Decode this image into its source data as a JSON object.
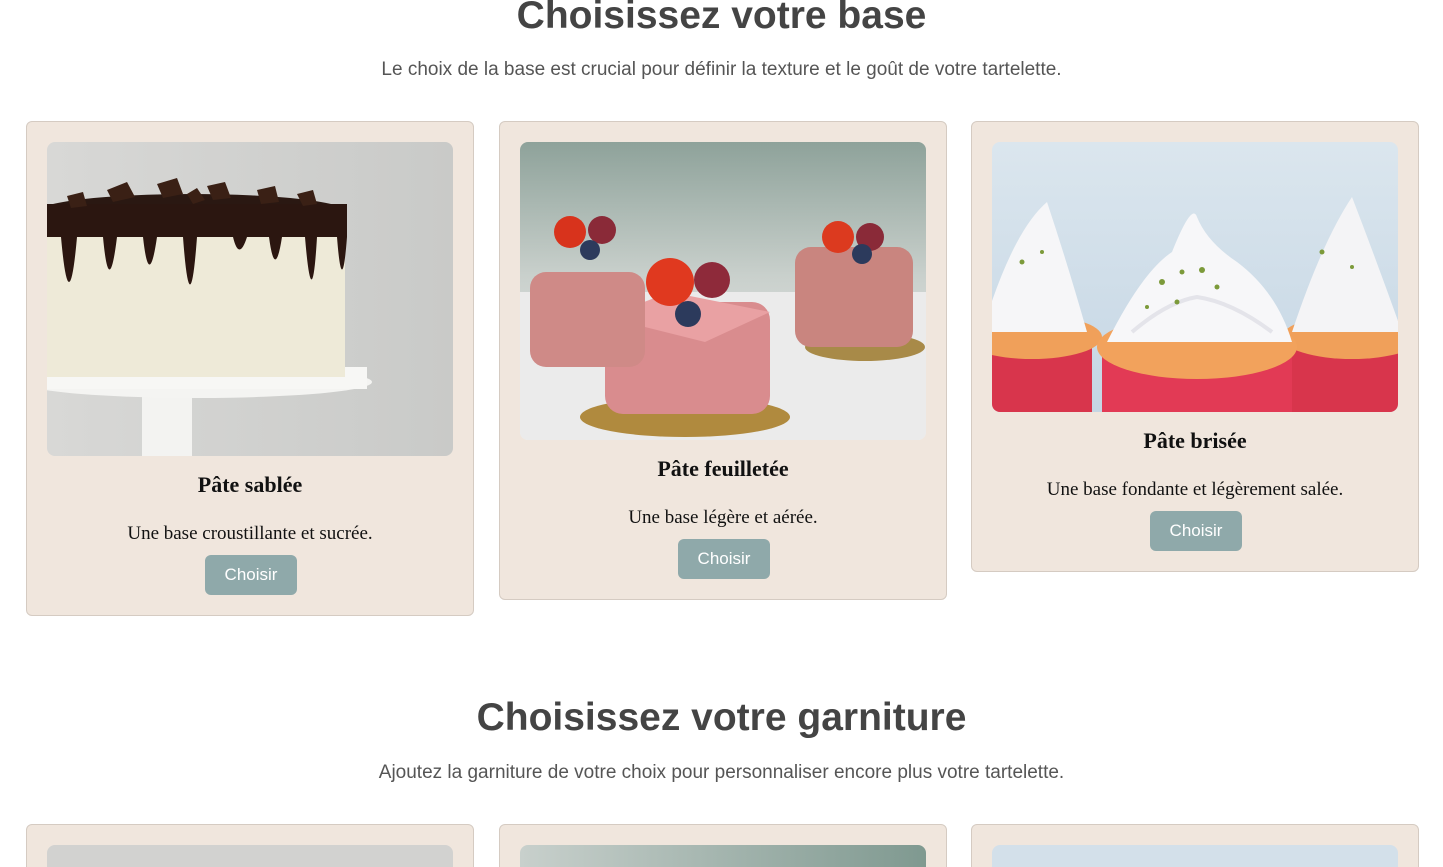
{
  "base_section": {
    "title": "Choisissez votre base",
    "subtitle": "Le choix de la base est crucial pour définir la texture et le goût de votre tartelette.",
    "cards": [
      {
        "title": "Pâte sablée",
        "description": "Une base croustillante et sucrée.",
        "button": "Choisir",
        "image": "chocolate-drip-cake-photo"
      },
      {
        "title": "Pâte feuilletée",
        "description": "Une base légère et aérée.",
        "button": "Choisir",
        "image": "pink-petit-fours-photo"
      },
      {
        "title": "Pâte brisée",
        "description": "Une base fondante et légèrement salée.",
        "button": "Choisir",
        "image": "meringue-cupcakes-photo"
      }
    ]
  },
  "garniture_section": {
    "title": "Choisissez votre garniture",
    "subtitle": "Ajoutez la garniture de votre choix pour personnaliser encore plus votre tartelette."
  },
  "colors": {
    "card_background": "#f0e6dd",
    "button": "#8fa9aa",
    "heading": "#444444"
  }
}
